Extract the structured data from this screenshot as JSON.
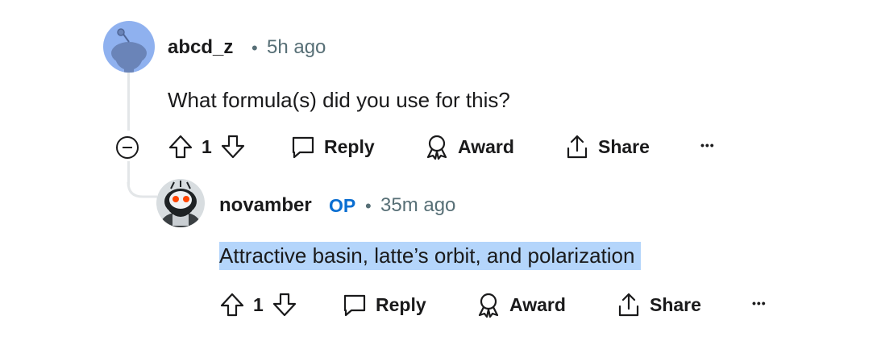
{
  "comment": {
    "username": "abcd_z",
    "separator": "•",
    "time": "5h ago",
    "body": "What formula(s) did you use for this?",
    "vote_count": "1",
    "reply_label": "Reply",
    "award_label": "Award",
    "share_label": "Share",
    "more_label": "•••"
  },
  "reply": {
    "username": "novamber",
    "op_badge": "OP",
    "separator": "•",
    "time": "35m ago",
    "body": "Attractive basin, latte’s orbit, and polarization",
    "vote_count": "1",
    "reply_label": "Reply",
    "award_label": "Award",
    "share_label": "Share",
    "more_label": "•••"
  },
  "colors": {
    "avatar_bg": "#8fb1ef",
    "highlight": "#b4d5fb",
    "op": "#0a6ed1",
    "meta": "#576f76"
  }
}
